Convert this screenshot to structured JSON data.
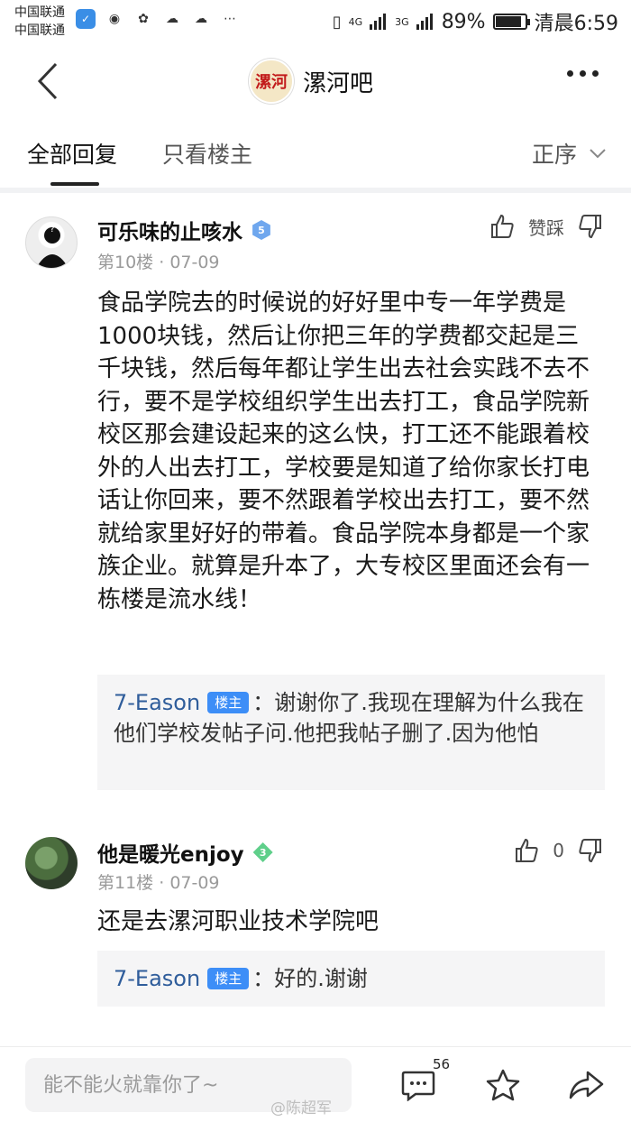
{
  "status_bar": {
    "carrier1": "中国联通",
    "carrier2": "中国联通",
    "signal1": "4G",
    "signal2": "3G",
    "battery": "89%",
    "time": "清晨6:59",
    "battery_level": 0.89
  },
  "nav": {
    "bar_icon_text": "漯河",
    "title": "漯河吧"
  },
  "tabs": {
    "all_label": "全部回复",
    "owner_only_label": "只看楼主",
    "sort_label": "正序"
  },
  "posts": [
    {
      "username": "可乐味的止咳水",
      "level": "5",
      "floor": "第10楼",
      "date": "07-09",
      "like_label": "赞踩",
      "content": "食品学院去的时候说的好好里中专一年学费是1000块钱，然后让你把三年的学费都交起是三千块钱，然后每年都让学生出去社会实践不去不行，要不是学校组织学生出去打工，食品学院新校区那会建设起来的这么快，打工还不能跟着校外的人出去打工，学校要是知道了给你家长打电话让你回来，要不然跟着学校出去打工，要不然就给家里好好的带着。食品学院本身都是一个家族企业。就算是升本了，大专校区里面还会有一栋楼是流水线！",
      "reply": {
        "name": "7-Eason",
        "tag": "楼主",
        "text": "：谢谢你了.我现在理解为什么我在他们学校发帖子问.他把我帖子删了.因为他怕"
      }
    },
    {
      "username": "他是暖光enjoy",
      "level": "3",
      "floor": "第11楼",
      "date": "07-09",
      "like_label": "0",
      "content": "还是去漯河职业技术学院吧",
      "reply": {
        "name": "7-Eason",
        "tag": "楼主",
        "text": "：好的.谢谢"
      }
    }
  ],
  "bottom_bar": {
    "input_placeholder": "能不能火就靠你了~",
    "comment_count": "56"
  },
  "watermark": "@陈超军"
}
